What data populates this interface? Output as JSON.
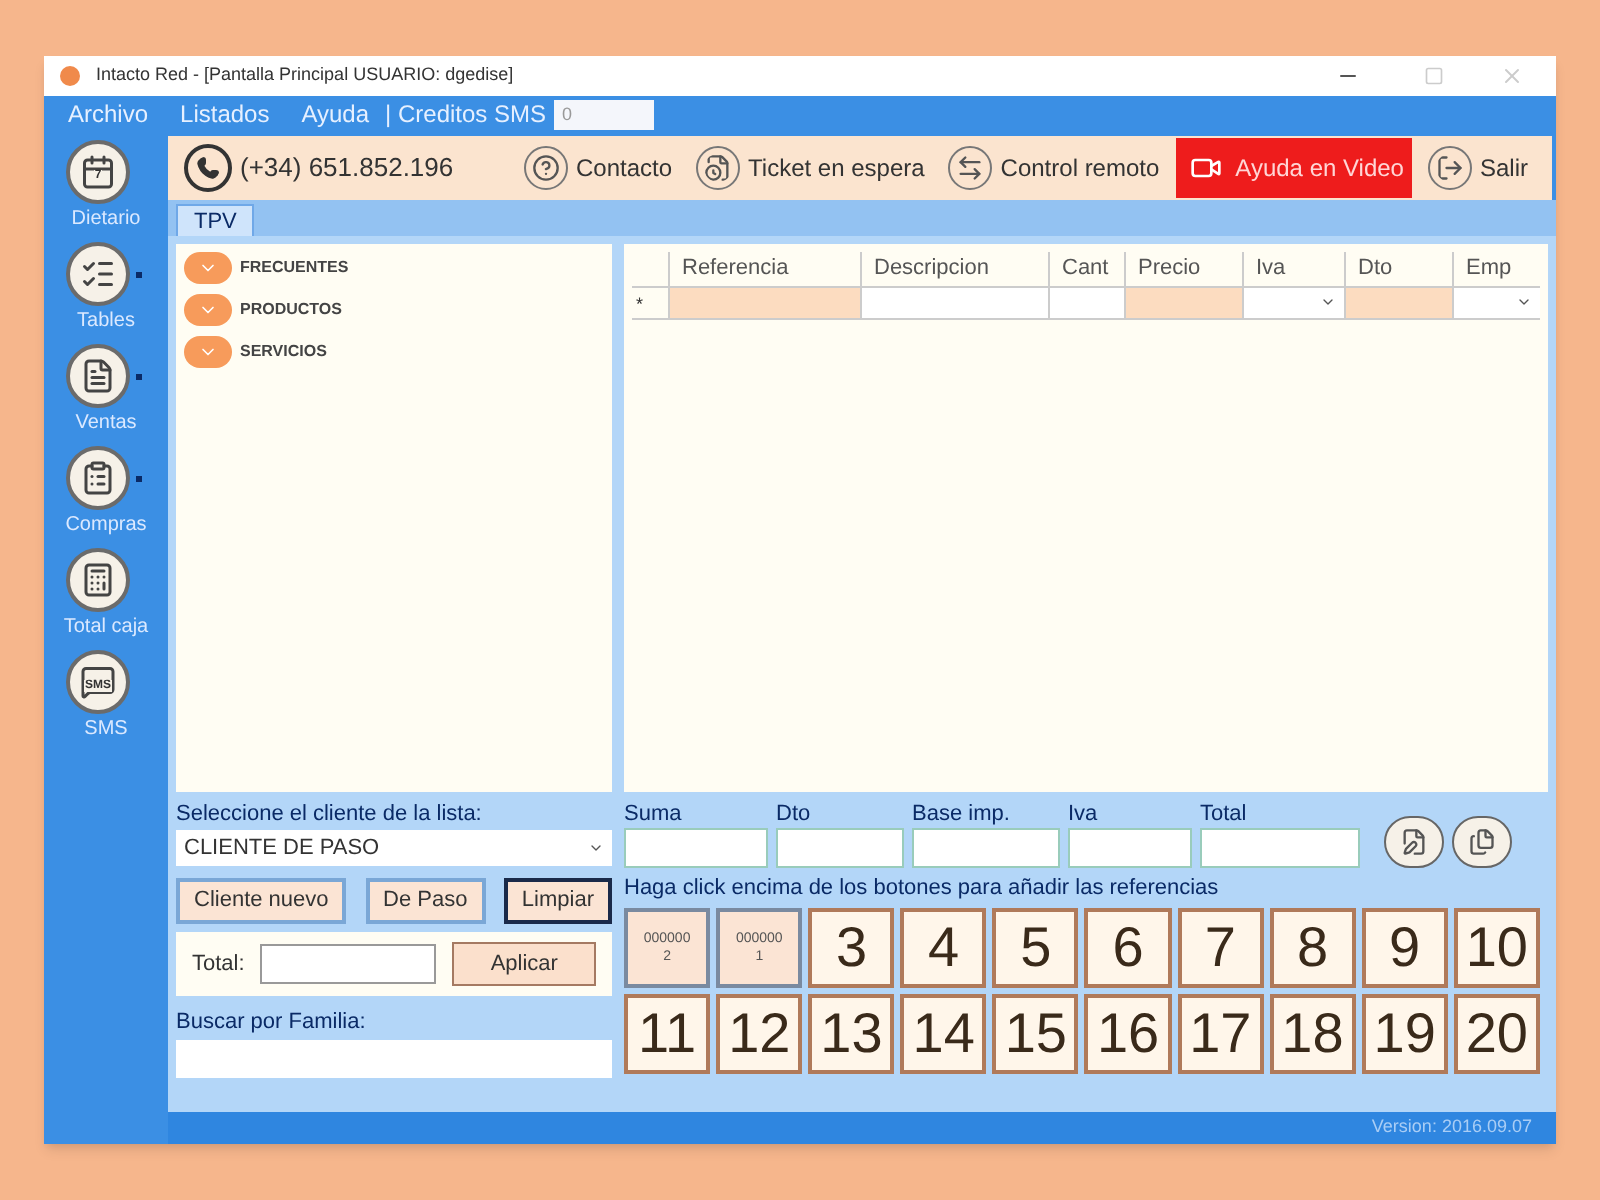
{
  "window": {
    "title": "Intacto Red - [Pantalla Principal USUARIO: dgedise]"
  },
  "menu": {
    "items": [
      "Archivo",
      "Listados",
      "Ayuda"
    ],
    "credits_label": "| Creditos SMS",
    "credits_value": "0"
  },
  "sidebar": {
    "items": [
      {
        "label": "Dietario",
        "has_menu": false,
        "badge": "7"
      },
      {
        "label": "Tables",
        "has_menu": true
      },
      {
        "label": "Ventas",
        "has_menu": true
      },
      {
        "label": "Compras",
        "has_menu": true
      },
      {
        "label": "Total caja",
        "has_menu": false
      },
      {
        "label": "SMS",
        "has_menu": false,
        "badge": "SMS"
      }
    ]
  },
  "toolbar": {
    "phone": "(+34) 651.852.196",
    "buttons": [
      {
        "label": "Contacto",
        "highlighted": false
      },
      {
        "label": "Ticket en espera",
        "highlighted": false
      },
      {
        "label": "Control remoto",
        "highlighted": false
      },
      {
        "label": "Ayuda en Video",
        "highlighted": true
      },
      {
        "label": "Salir",
        "highlighted": false
      }
    ]
  },
  "tabs": [
    {
      "label": "TPV",
      "selected": true
    }
  ],
  "families": [
    "FRECUENTES",
    "PRODUCTOS",
    "SERVICIOS"
  ],
  "table": {
    "columns": [
      {
        "label": "Referencia",
        "highlighted": true,
        "dropdown": false
      },
      {
        "label": "Descripcion",
        "highlighted": false,
        "dropdown": false
      },
      {
        "label": "Cant",
        "highlighted": false,
        "dropdown": false
      },
      {
        "label": "Precio",
        "highlighted": true,
        "dropdown": false
      },
      {
        "label": "Iva",
        "highlighted": false,
        "dropdown": true
      },
      {
        "label": "Dto",
        "highlighted": true,
        "dropdown": false
      },
      {
        "label": "Emp",
        "highlighted": false,
        "dropdown": true
      }
    ],
    "new_row_marker": "*"
  },
  "client": {
    "label": "Seleccione el cliente de la lista:",
    "value": "CLIENTE DE PASO",
    "buttons": [
      {
        "label": "Cliente nuevo",
        "focused": false
      },
      {
        "label": "De Paso",
        "focused": false
      },
      {
        "label": "Limpiar",
        "focused": true
      }
    ],
    "total_label": "Total:",
    "apply": "Aplicar",
    "family_search_label": "Buscar por Familia:"
  },
  "totals": [
    "Suma",
    "Dto",
    "Base imp.",
    "Iva",
    "Total"
  ],
  "hint": "Haga click encima de los botones para añadir las referencias",
  "reference_buttons": [
    {
      "kind": "product",
      "code": "000000",
      "label": "2"
    },
    {
      "kind": "product",
      "code": "000000",
      "label": "1"
    },
    {
      "kind": "number",
      "label": "3"
    },
    {
      "kind": "number",
      "label": "4"
    },
    {
      "kind": "number",
      "label": "5"
    },
    {
      "kind": "number",
      "label": "6"
    },
    {
      "kind": "number",
      "label": "7"
    },
    {
      "kind": "number",
      "label": "8"
    },
    {
      "kind": "number",
      "label": "9"
    },
    {
      "kind": "number",
      "label": "10"
    },
    {
      "kind": "number",
      "label": "11"
    },
    {
      "kind": "number",
      "label": "12"
    },
    {
      "kind": "number",
      "label": "13"
    },
    {
      "kind": "number",
      "label": "14"
    },
    {
      "kind": "number",
      "label": "15"
    },
    {
      "kind": "number",
      "label": "16"
    },
    {
      "kind": "number",
      "label": "17"
    },
    {
      "kind": "number",
      "label": "18"
    },
    {
      "kind": "number",
      "label": "19"
    },
    {
      "kind": "number",
      "label": "20"
    }
  ],
  "status_bar": {
    "version": "Version: 2016.09.07"
  }
}
